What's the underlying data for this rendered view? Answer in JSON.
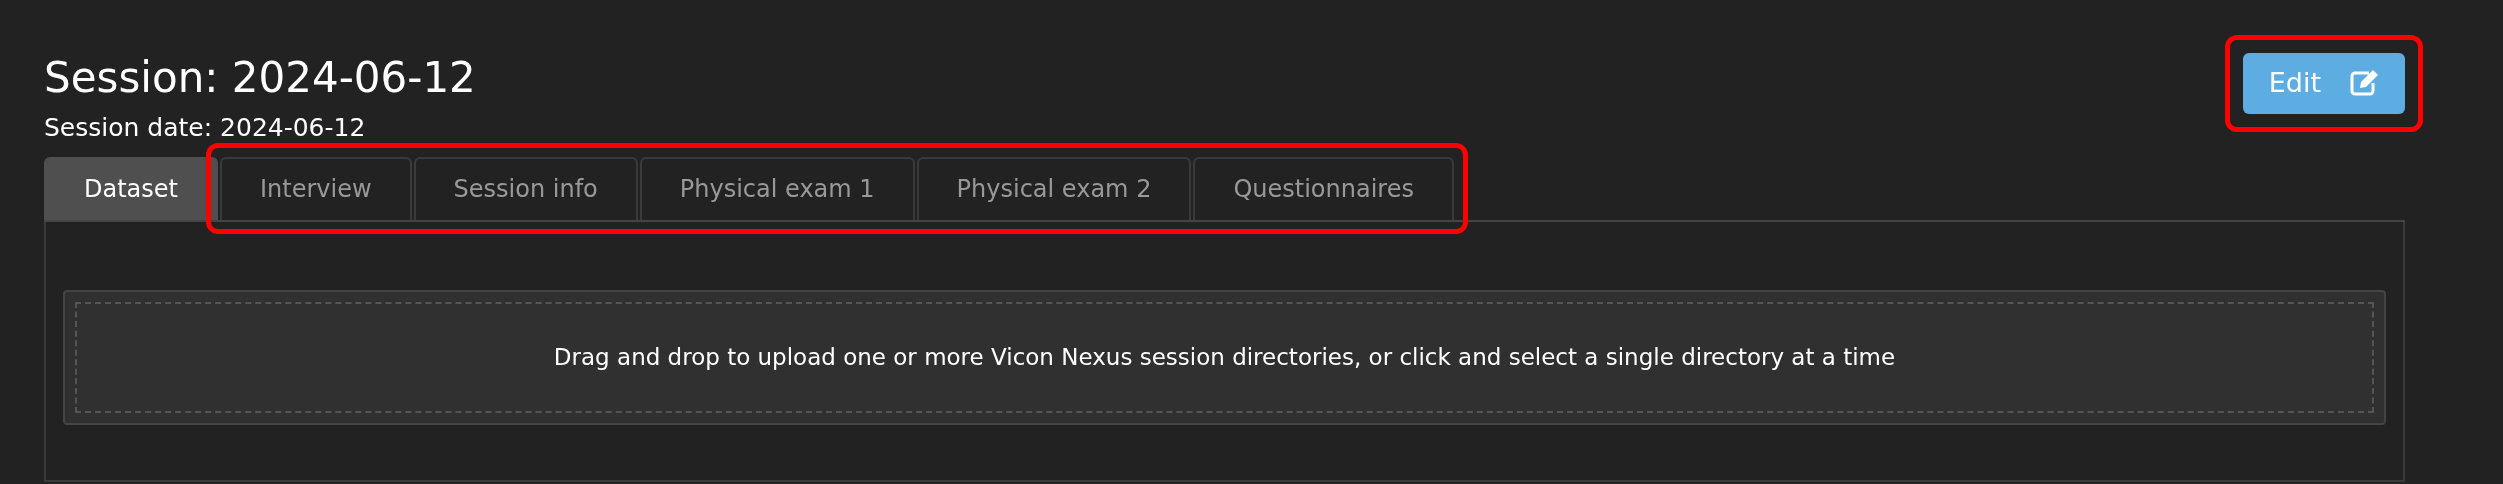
{
  "header": {
    "title": "Session: 2024-06-12",
    "subtitle": "Session date: 2024-06-12"
  },
  "edit_button": {
    "label": "Edit",
    "highlighted": true
  },
  "tabs_highlighted": true,
  "tabs": [
    {
      "label": "Dataset",
      "selected": true
    },
    {
      "label": "Interview",
      "selected": false
    },
    {
      "label": "Session info",
      "selected": false
    },
    {
      "label": "Physical exam 1",
      "selected": false
    },
    {
      "label": "Physical exam 2",
      "selected": false
    },
    {
      "label": "Questionnaires",
      "selected": false
    }
  ],
  "dropzone": {
    "text": "Drag and drop to upload one or more Vicon Nexus session directories, or click and select a single directory at a time"
  }
}
